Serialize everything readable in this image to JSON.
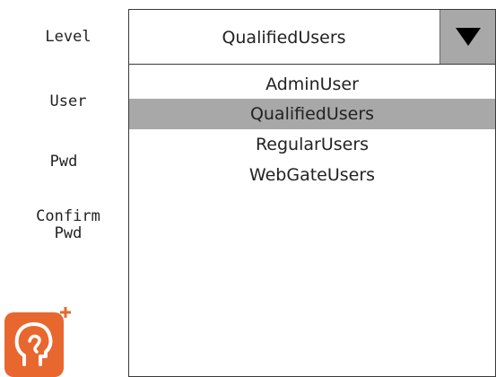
{
  "form": {
    "level_label": "Level",
    "user_label": "User",
    "pwd_label": "Pwd",
    "confirm_label_line1": "Confirm",
    "confirm_label_line2": "Pwd"
  },
  "level_select": {
    "selected": "QualifiedUsers",
    "arrow_icon": "triangle-down-icon",
    "options": [
      "AdminUser",
      "QualifiedUsers",
      "RegularUsers",
      "WebGateUsers"
    ],
    "highlighted_index": 1
  },
  "app_icon": {
    "icon": "head-profile-plus-icon",
    "color": "#e8672e"
  },
  "colors": {
    "highlight": "#a8a8a8",
    "border": "#3a3a3a"
  }
}
